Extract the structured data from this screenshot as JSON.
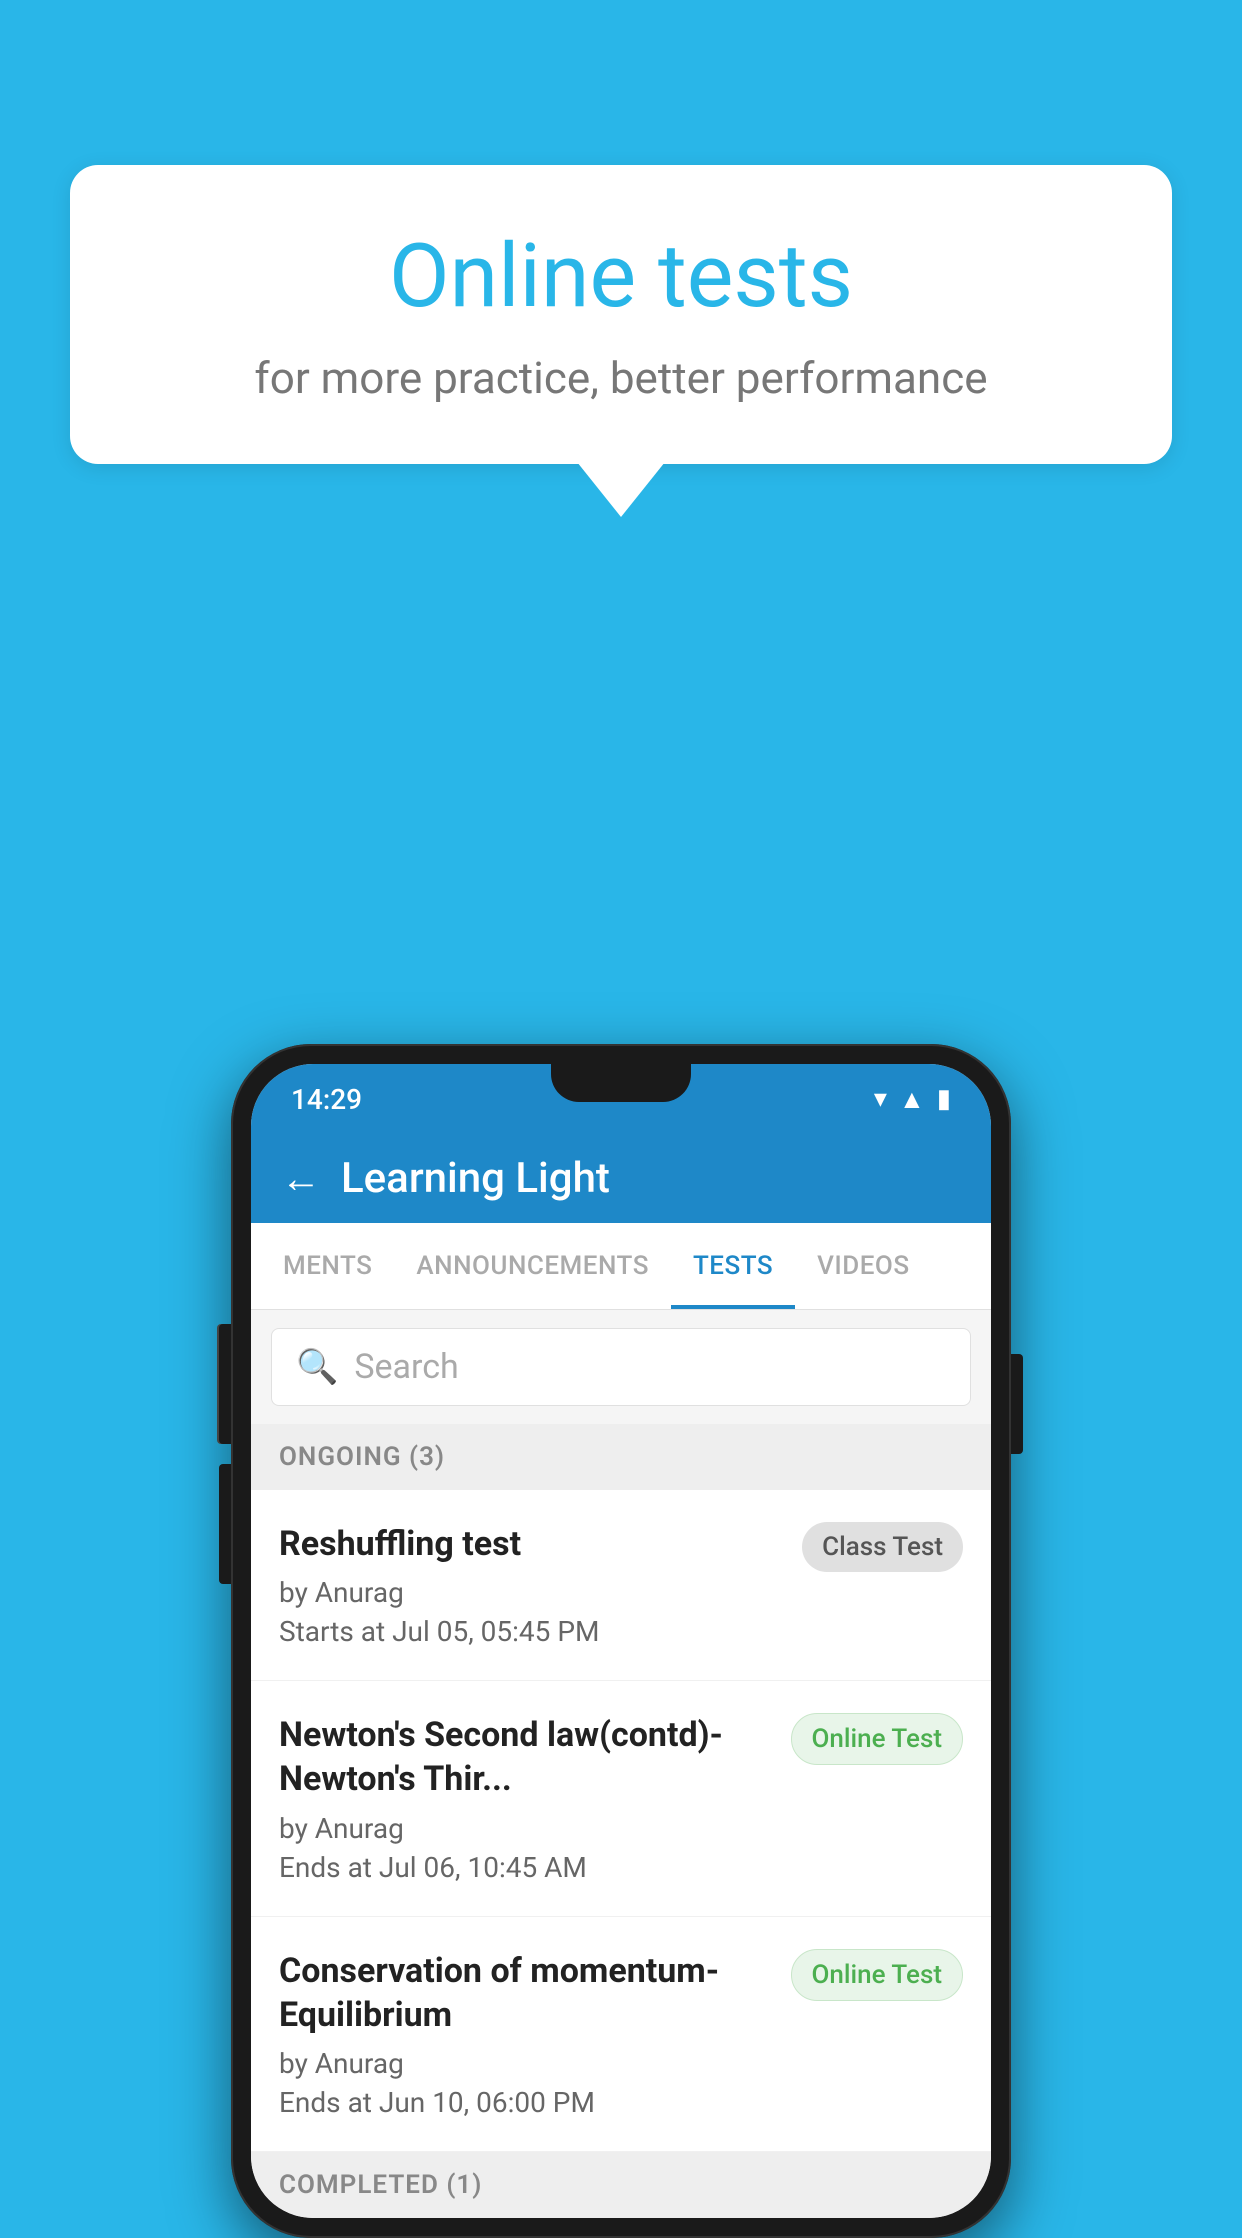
{
  "background_color": "#29b6e8",
  "bubble": {
    "title": "Online tests",
    "subtitle": "for more practice, better performance"
  },
  "phone": {
    "status_bar": {
      "time": "14:29",
      "icons": [
        "wifi",
        "signal",
        "battery"
      ]
    },
    "header": {
      "title": "Learning Light",
      "back_label": "←"
    },
    "tabs": [
      {
        "label": "MENTS",
        "active": false
      },
      {
        "label": "ANNOUNCEMENTS",
        "active": false
      },
      {
        "label": "TESTS",
        "active": true
      },
      {
        "label": "VIDEOS",
        "active": false
      }
    ],
    "search": {
      "placeholder": "Search"
    },
    "ongoing_section": {
      "title": "ONGOING (3)"
    },
    "test_items": [
      {
        "name": "Reshuffling test",
        "author": "by Anurag",
        "date": "Starts at  Jul 05, 05:45 PM",
        "badge": "Class Test",
        "badge_type": "gray"
      },
      {
        "name": "Newton's Second law(contd)-Newton's Thir...",
        "author": "by Anurag",
        "date": "Ends at  Jul 06, 10:45 AM",
        "badge": "Online Test",
        "badge_type": "green"
      },
      {
        "name": "Conservation of momentum-Equilibrium",
        "author": "by Anurag",
        "date": "Ends at  Jun 10, 06:00 PM",
        "badge": "Online Test",
        "badge_type": "green"
      }
    ],
    "completed_section": {
      "title": "COMPLETED (1)"
    }
  }
}
